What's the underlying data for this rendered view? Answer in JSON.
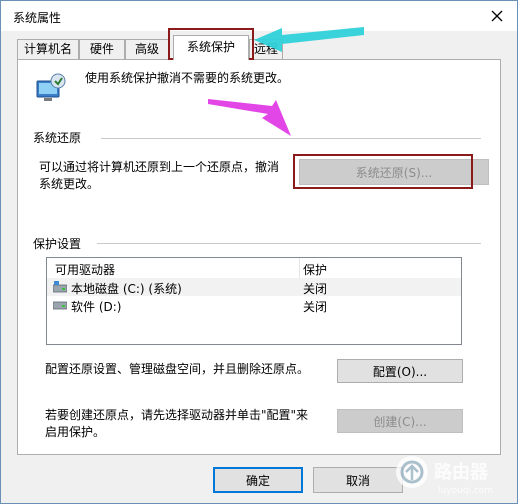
{
  "window": {
    "title": "系统属性"
  },
  "tabs": [
    {
      "label": "计算机名"
    },
    {
      "label": "硬件"
    },
    {
      "label": "高级"
    },
    {
      "label": "系统保护"
    },
    {
      "label": "远程"
    }
  ],
  "active_tab": "系统保护",
  "intro_text": "使用系统保护撤消不需要的系统更改。",
  "restore_section": {
    "label": "系统还原",
    "description_line1": "可以通过将计算机还原到上一个还原点，撤消",
    "description_line2": "系统更改。",
    "button_label": "系统还原(S)..."
  },
  "protection_section": {
    "label": "保护设置",
    "columns": [
      "可用驱动器",
      "保护"
    ],
    "drives": [
      {
        "name": "本地磁盘 (C:) (系统)",
        "protection": "关闭"
      },
      {
        "name": "软件 (D:)",
        "protection": "关闭"
      }
    ],
    "configure_text": "配置还原设置、管理磁盘空间，并且删除还原点。",
    "configure_button": "配置(O)...",
    "create_text_line1": "若要创建还原点，请先选择驱动器并单击\"配置\"来",
    "create_text_line2": "启用保护。",
    "create_button": "创建(C)..."
  },
  "footer": {
    "ok_label": "确定",
    "cancel_label": "取消"
  },
  "watermark": {
    "brand": "路由器",
    "domain": "luyouqi.com"
  },
  "colors": {
    "highlight_box": "#8b1a1a",
    "arrow_cyan": "#2fd1d9",
    "arrow_magenta": "#e23ce6",
    "focus_blue": "#0078d7"
  },
  "icons": {
    "close": "close-icon",
    "system": "system-protection-icon",
    "drive_system": "system-drive-icon",
    "drive": "drive-icon"
  }
}
